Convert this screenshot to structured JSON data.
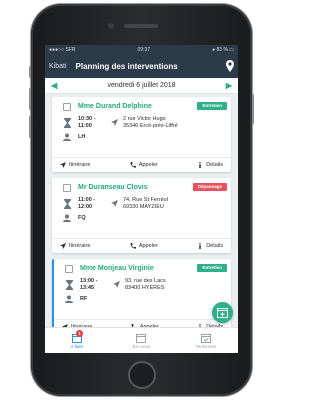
{
  "statusbar": {
    "carrier": "●●●○○ SFR",
    "time": "09:37",
    "battery": "● 83 % ▭"
  },
  "appbar": {
    "brand": "Kibati",
    "title": "Planning des interventions"
  },
  "datebar": {
    "prev": "◀",
    "date": "vendredi 6 juillet 2018",
    "next": "▶"
  },
  "interventions": [
    {
      "client": "Mme Durand Delphine",
      "type": "Entretien",
      "type_color": "#2fb08a",
      "time_start": "10:30 -",
      "time_end": "11:00",
      "address_line1": "2 rue Victor Hugo",
      "address_line2": "35340 Ercé-près-Liffré",
      "technician": "LH"
    },
    {
      "client": "Mr Duranseau Clovis",
      "type": "Dépannage",
      "type_color": "#e8525e",
      "time_start": "11:00 -",
      "time_end": "12:00",
      "address_line1": "74, Rue St Ferréol",
      "address_line2": "69330 MAYZIEU",
      "technician": "FQ"
    },
    {
      "client": "Mme Monjeau Virginie",
      "type": "Entretien",
      "type_color": "#2fb08a",
      "time_start": "13:00 -",
      "time_end": "13:45",
      "address_line1": "93, rue des Lacs",
      "address_line2": "83400 HYÈRES",
      "technician": "RF"
    }
  ],
  "actions": {
    "itinerary": "Itinéraire",
    "call": "Appeler",
    "details": "Détails"
  },
  "tabs": [
    {
      "label": "A faire",
      "count": "1"
    },
    {
      "label": "En cours"
    },
    {
      "label": "Terminées"
    }
  ],
  "colors": {
    "header": "#2c3b49",
    "accent": "#2fb08a",
    "active": "#2f8fd8"
  }
}
